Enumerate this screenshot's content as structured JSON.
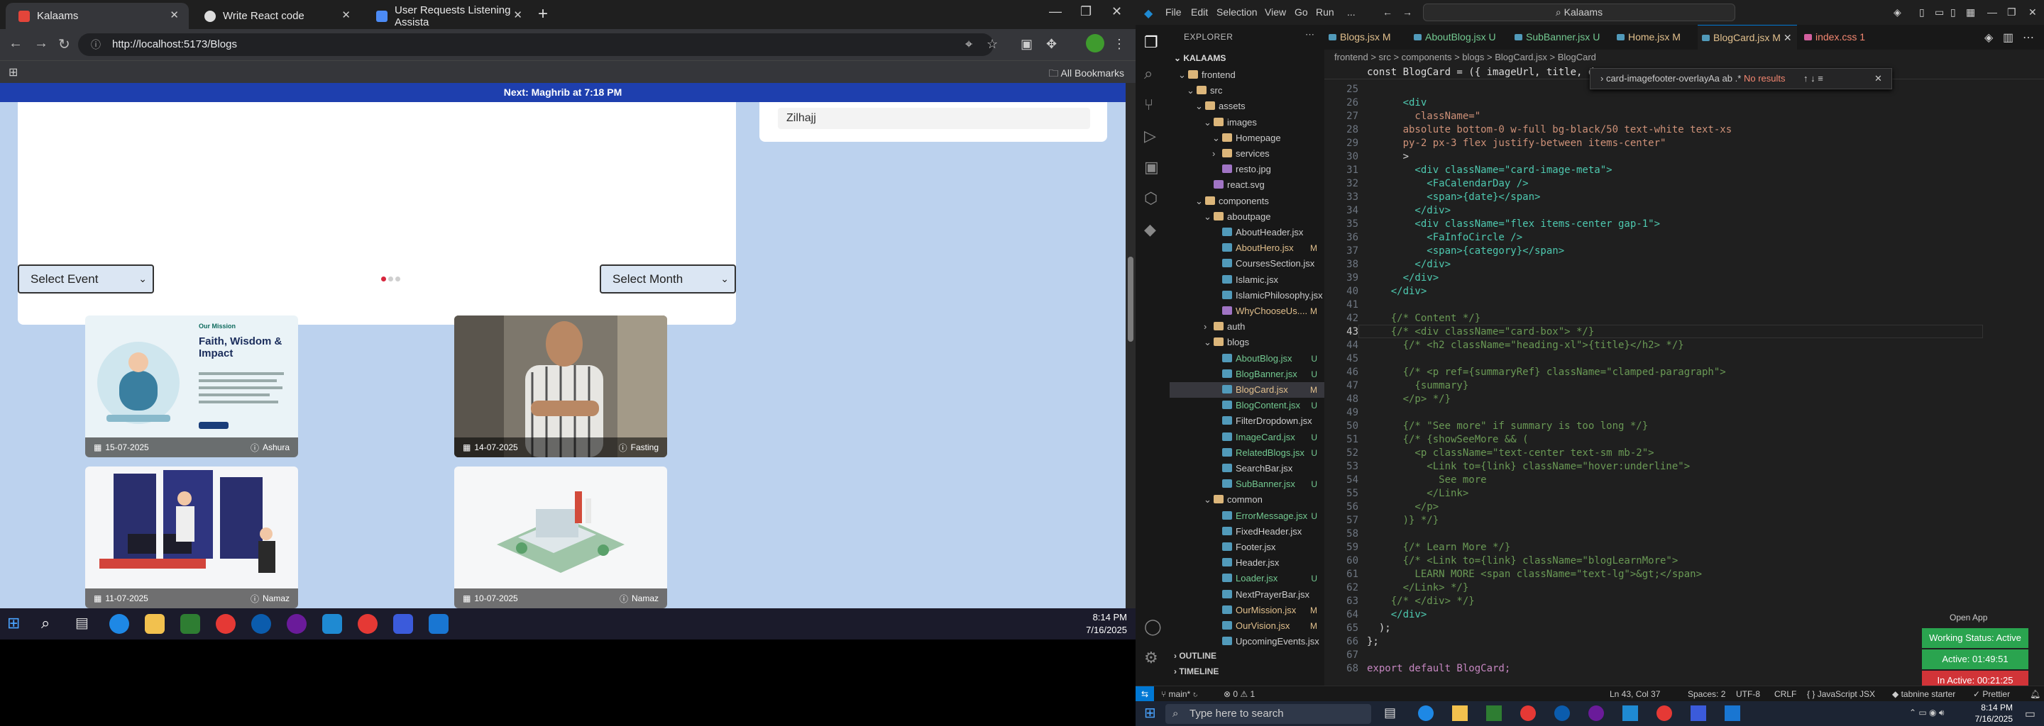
{
  "browser": {
    "tabs": [
      {
        "label": "Kalaams",
        "active": true
      },
      {
        "label": "Write React code",
        "active": false
      },
      {
        "label": "User Requests Listening Assista",
        "active": false
      }
    ],
    "url": "http://localhost:5173/Blogs",
    "all_bookmarks": "All Bookmarks"
  },
  "page": {
    "prayer_banner": "Next: Maghrib at 7:18 PM",
    "side_item": "Zilhajj",
    "select_event": "Select Event",
    "select_month": "Select Month",
    "cards": [
      {
        "date": "15-07-2025",
        "category": "Ashura",
        "image": "mission-illustration",
        "text_title": "Our Mission",
        "text_heading": "Faith, Wisdom & Impact"
      },
      {
        "date": "14-07-2025",
        "category": "Fasting",
        "image": "man-photo"
      },
      {
        "date": "11-07-2025",
        "category": "Namaz",
        "image": "office-illustration"
      },
      {
        "date": "10-07-2025",
        "category": "Namaz",
        "image": "factory-illustration"
      }
    ]
  },
  "taskbar_left": {
    "time": "8:14 PM",
    "date": "7/16/2025"
  },
  "vscode": {
    "title_search": "Kalaams",
    "menu": [
      "File",
      "Edit",
      "Selection",
      "View",
      "Go",
      "Run",
      "..."
    ],
    "explorer_header": "EXPLORER",
    "project": "KALAAMS",
    "tree": [
      {
        "name": "frontend",
        "type": "folder",
        "depth": 1
      },
      {
        "name": "src",
        "type": "folder",
        "depth": 2
      },
      {
        "name": "assets",
        "type": "folder",
        "depth": 3
      },
      {
        "name": "images",
        "type": "folder",
        "depth": 4
      },
      {
        "name": "Homepage",
        "type": "folder",
        "depth": 5
      },
      {
        "name": "services",
        "type": "folder-closed",
        "depth": 5
      },
      {
        "name": "resto.jpg",
        "type": "file",
        "depth": 5
      },
      {
        "name": "react.svg",
        "type": "file",
        "depth": 4
      },
      {
        "name": "components",
        "type": "folder",
        "depth": 3
      },
      {
        "name": "aboutpage",
        "type": "folder",
        "depth": 4
      },
      {
        "name": "AboutHeader.jsx",
        "type": "file",
        "depth": 5,
        "badge": ""
      },
      {
        "name": "AboutHero.jsx",
        "type": "file",
        "depth": 5,
        "badge": "M"
      },
      {
        "name": "CoursesSection.jsx",
        "type": "file",
        "depth": 5,
        "badge": ""
      },
      {
        "name": "Islamic.jsx",
        "type": "file",
        "depth": 5,
        "badge": ""
      },
      {
        "name": "IslamicPhilosophy.jsx",
        "type": "file",
        "depth": 5,
        "badge": ""
      },
      {
        "name": "WhyChooseUs....",
        "type": "file",
        "depth": 5,
        "badge": "M"
      },
      {
        "name": "auth",
        "type": "folder-closed",
        "depth": 4
      },
      {
        "name": "blogs",
        "type": "folder",
        "depth": 4
      },
      {
        "name": "AboutBlog.jsx",
        "type": "file",
        "depth": 5,
        "badge": "U"
      },
      {
        "name": "BlogBanner.jsx",
        "type": "file",
        "depth": 5,
        "badge": "U"
      },
      {
        "name": "BlogCard.jsx",
        "type": "file",
        "depth": 5,
        "badge": "M",
        "selected": true
      },
      {
        "name": "BlogContent.jsx",
        "type": "file",
        "depth": 5,
        "badge": "U"
      },
      {
        "name": "FilterDropdown.jsx",
        "type": "file",
        "depth": 5,
        "badge": ""
      },
      {
        "name": "ImageCard.jsx",
        "type": "file",
        "depth": 5,
        "badge": "U"
      },
      {
        "name": "RelatedBlogs.jsx",
        "type": "file",
        "depth": 5,
        "badge": "U"
      },
      {
        "name": "SearchBar.jsx",
        "type": "file",
        "depth": 5,
        "badge": ""
      },
      {
        "name": "SubBanner.jsx",
        "type": "file",
        "depth": 5,
        "badge": "U"
      },
      {
        "name": "common",
        "type": "folder",
        "depth": 4
      },
      {
        "name": "ErrorMessage.jsx",
        "type": "file",
        "depth": 5,
        "badge": "U"
      },
      {
        "name": "FixedHeader.jsx",
        "type": "file",
        "depth": 5,
        "badge": ""
      },
      {
        "name": "Footer.jsx",
        "type": "file",
        "depth": 5,
        "badge": ""
      },
      {
        "name": "Header.jsx",
        "type": "file",
        "depth": 5,
        "badge": ""
      },
      {
        "name": "Loader.jsx",
        "type": "file",
        "depth": 5,
        "badge": "U"
      },
      {
        "name": "NextPrayerBar.jsx",
        "type": "file",
        "depth": 5,
        "badge": ""
      },
      {
        "name": "OurMission.jsx",
        "type": "file",
        "depth": 5,
        "badge": "M"
      },
      {
        "name": "OurVision.jsx",
        "type": "file",
        "depth": 5,
        "badge": "M"
      },
      {
        "name": "UpcomingEvents.jsx",
        "type": "file",
        "depth": 5,
        "badge": ""
      }
    ],
    "outline": "OUTLINE",
    "timeline": "TIMELINE",
    "editor_tabs": [
      {
        "label": "Blogs.jsx",
        "badge": "M",
        "active": false
      },
      {
        "label": "AboutBlog.jsx",
        "badge": "U",
        "active": false
      },
      {
        "label": "SubBanner.jsx",
        "badge": "U",
        "active": false
      },
      {
        "label": "Home.jsx",
        "badge": "M",
        "active": false
      },
      {
        "label": "BlogCard.jsx",
        "badge": "M",
        "active": true
      },
      {
        "label": "index.css",
        "badge": "1",
        "active": false
      }
    ],
    "breadcrumbs": "frontend > src > components > blogs > BlogCard.jsx > BlogCard",
    "sticky_line": "const BlogCard = ({ imageUrl, title, date, category",
    "find_query": "card-imagefooter-overlay",
    "find_result": "No results",
    "line_numbers": [
      "25",
      "26",
      "27",
      "28",
      "29",
      "30",
      "31",
      "32",
      "33",
      "34",
      "35",
      "36",
      "37",
      "38",
      "39",
      "40",
      "41",
      "42",
      "43",
      "44",
      "45",
      "46",
      "47",
      "48",
      "49",
      "50",
      "51",
      "52",
      "53",
      "54",
      "55",
      "56",
      "57",
      "58",
      "59",
      "60",
      "61",
      "62",
      "63",
      "64",
      "65",
      "66",
      "67",
      "68"
    ],
    "code_lines": [
      "",
      "      <div",
      "        className=\"",
      "      absolute bottom-0 w-full bg-black/50 text-white text-xs",
      "      py-2 px-3 flex justify-between items-center\"",
      "      >",
      "        <div className=\"card-image-meta\">",
      "          <FaCalendarDay />",
      "          <span>{date}</span>",
      "        </div>",
      "        <div className=\"flex items-center gap-1\">",
      "          <FaInfoCircle />",
      "          <span>{category}</span>",
      "        </div>",
      "      </div>",
      "    </div>",
      "",
      "    {/* Content */}",
      "    {/* <div className=\"card-box\"> */}",
      "      {/* <h2 className=\"heading-xl\">{title}</h2> */}",
      "",
      "      {/* <p ref={summaryRef} className=\"clamped-paragraph\">",
      "        {summary}",
      "      </p> */}",
      "",
      "      {/* \"See more\" if summary is too long */}",
      "      {/* {showSeeMore && (",
      "        <p className=\"text-center text-sm mb-2\">",
      "          <Link to={link} className=\"hover:underline\">",
      "            See more",
      "          </Link>",
      "        </p>",
      "      )} */}",
      "",
      "      {/* Learn More */}",
      "      {/* <Link to={link} className=\"blogLearnMore\">",
      "        LEARN MORE <span className=\"text-lg\">&gt;</span>",
      "      </Link> */}",
      "    {/* </div> */}",
      "    </div>",
      "  );",
      "};",
      "",
      "export default BlogCard;"
    ],
    "status": {
      "branch": "main*",
      "problems": "⊗ 0 ⚠ 1",
      "position": "Ln 43, Col 37",
      "spaces": "Spaces: 2",
      "encoding": "UTF-8",
      "eol": "CRLF",
      "language": "JavaScript JSX",
      "tabnine": "tabnine starter",
      "prettier": "Prettier"
    },
    "open_app": "Open App",
    "working_status": "Working Status: Active",
    "active_time": "Active: 01:49:51",
    "inactive_time": "In Active: 00:21:25"
  },
  "taskbar_right": {
    "search_placeholder": "Type here to search",
    "time": "8:14 PM",
    "date": "7/16/2025"
  },
  "colors": {
    "page_bg": "#bcd2ee",
    "prayer_bar": "#1e3fae",
    "accent": "#0078d4",
    "status_green": "#2aa44f",
    "status_red": "#d13438"
  }
}
